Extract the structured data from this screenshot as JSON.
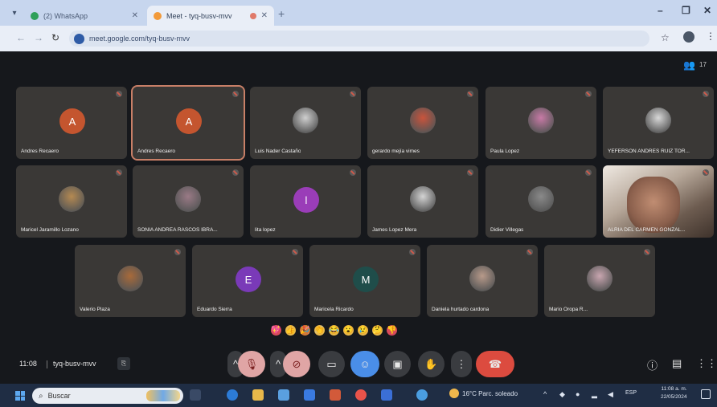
{
  "browser": {
    "tabs": [
      {
        "title": "(2) WhatsApp",
        "active": false,
        "favicon_color": "#2fa05a"
      },
      {
        "title": "Meet - tyq-busv-mvv",
        "active": true,
        "favicon_color": "#f29a3a"
      }
    ],
    "new_tab_label": "+",
    "url": "meet.google.com/tyq-busv-mvv",
    "window_controls": [
      "–",
      "❐",
      "✕"
    ]
  },
  "meet": {
    "participant_count": "17",
    "participants": [
      {
        "name": "Andres Recaero",
        "type": "initial",
        "initial": "A",
        "color": "#c4552f"
      },
      {
        "name": "Andres Recaero",
        "type": "initial",
        "initial": "A",
        "color": "#c4552f",
        "highlighted": true
      },
      {
        "name": "Luis Nader Castaño",
        "type": "photo",
        "color": "#cfcfcf"
      },
      {
        "name": "gerardo mejía vimes",
        "type": "photo",
        "color": "#c9543c"
      },
      {
        "name": "Paula Lopez",
        "type": "photo",
        "color": "#c87aa6"
      },
      {
        "name": "YEFERSON ANDRES RUIZ TOR...",
        "type": "photo",
        "color": "#d8d8d8"
      },
      {
        "name": "Maricel Jaramillo Lozano",
        "type": "photo",
        "color": "#b58a52"
      },
      {
        "name": "SONIA ANDREA RASCOS IBRA...",
        "type": "photo",
        "color": "#9a7a86"
      },
      {
        "name": "lita lopez",
        "type": "initial",
        "initial": "l",
        "color": "#9a3db8"
      },
      {
        "name": "James Lopez Mera",
        "type": "photo",
        "color": "#d4d4d4"
      },
      {
        "name": "Didier Villegas",
        "type": "photo",
        "color": "#8a8a8a"
      },
      {
        "name": "ALRIA DEL CARMEN GONZAL...",
        "type": "camera",
        "color": "#b08a74"
      },
      {
        "name": "Valerio Plaza",
        "type": "photo",
        "color": "#a86a3a"
      },
      {
        "name": "Eduardo Sierra",
        "type": "initial",
        "initial": "E",
        "color": "#7a3ab8"
      },
      {
        "name": "Maricela Ricardo",
        "type": "initial",
        "initial": "M",
        "color": "#1f4d4a"
      },
      {
        "name": "Daniela hurtado cardona",
        "type": "photo",
        "color": "#b89a8a"
      },
      {
        "name": "Mario Oropa R...",
        "type": "photo",
        "color": "#c9a6b0"
      }
    ],
    "reactions": [
      "💖",
      "👍",
      "🎉",
      "👏",
      "😂",
      "😮",
      "😢",
      "🤔",
      "👎"
    ],
    "clock": "11:08",
    "meeting_code": "tyq-busv-mvv",
    "controls": {
      "mic_label": "mic off",
      "cam_label": "camera off",
      "present_label": "present",
      "captions_label": "captions",
      "emoji_label": "reactions",
      "raise_hand_label": "raise hand",
      "more_label": "more options",
      "leave_label": "leave call"
    }
  },
  "taskbar": {
    "search_placeholder": "Buscar",
    "weather": "16°C Parc. soleado",
    "time": "11:08 a. m.",
    "date": "22/05/2024",
    "lang": "ESP"
  }
}
